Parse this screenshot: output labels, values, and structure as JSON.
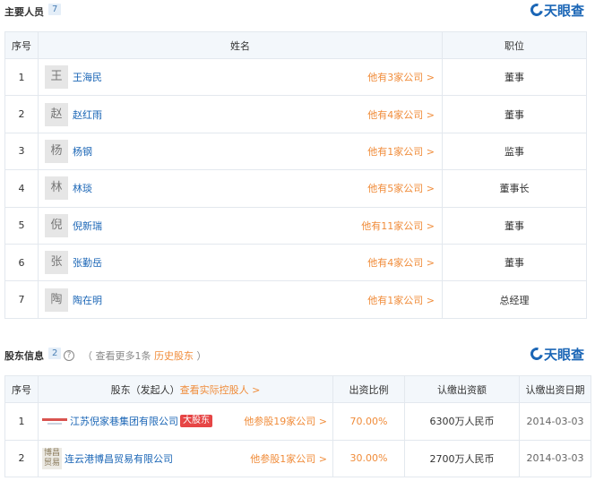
{
  "people_section": {
    "title": "主要人员",
    "count": "7",
    "brand": "天眼查",
    "columns": {
      "index": "序号",
      "name": "姓名",
      "position": "职位"
    },
    "rows": [
      {
        "index": "1",
        "avatar": "王",
        "name": "王海民",
        "companies": "他有3家公司 >",
        "position": "董事"
      },
      {
        "index": "2",
        "avatar": "赵",
        "name": "赵红雨",
        "companies": "他有4家公司 >",
        "position": "董事"
      },
      {
        "index": "3",
        "avatar": "杨",
        "name": "杨钢",
        "companies": "他有1家公司 >",
        "position": "监事"
      },
      {
        "index": "4",
        "avatar": "林",
        "name": "林琰",
        "companies": "他有5家公司 >",
        "position": "董事长"
      },
      {
        "index": "5",
        "avatar": "倪",
        "name": "倪新瑞",
        "companies": "他有11家公司 >",
        "position": "董事"
      },
      {
        "index": "6",
        "avatar": "张",
        "name": "张勤岳",
        "companies": "他有4家公司 >",
        "position": "董事"
      },
      {
        "index": "7",
        "avatar": "陶",
        "name": "陶在明",
        "companies": "他有1家公司 >",
        "position": "总经理"
      }
    ]
  },
  "shareholder_section": {
    "title": "股东信息",
    "count": "2",
    "help_icon": "?",
    "more_prefix": "（  查看更多1条",
    "more_link": "历史股东",
    "more_suffix": "）",
    "brand": "天眼查",
    "columns": {
      "index": "序号",
      "shareholder": "股东（发起人）",
      "controller_link": "查看实际控股人 >",
      "ratio": "出资比例",
      "amount": "认缴出资额",
      "date": "认缴出资日期"
    },
    "rows": [
      {
        "index": "1",
        "logo_text": "",
        "name": "江苏倪家巷集团有限公司",
        "tag": "大股东",
        "companies": "他参股19家公司 >",
        "ratio": "70.00%",
        "amount": "6300万人民币",
        "date": "2014-03-03"
      },
      {
        "index": "2",
        "logo_text": "博昌贸易",
        "name": "连云港博昌贸易有限公司",
        "tag": "",
        "companies": "他参股1家公司 >",
        "ratio": "30.00%",
        "amount": "2700万人民币",
        "date": "2014-03-03"
      }
    ]
  },
  "colors": {
    "link_blue": "#1b66b6",
    "accent_orange": "#f08c3a",
    "tag_red": "#e64545",
    "header_bg": "#f3f7fb"
  }
}
